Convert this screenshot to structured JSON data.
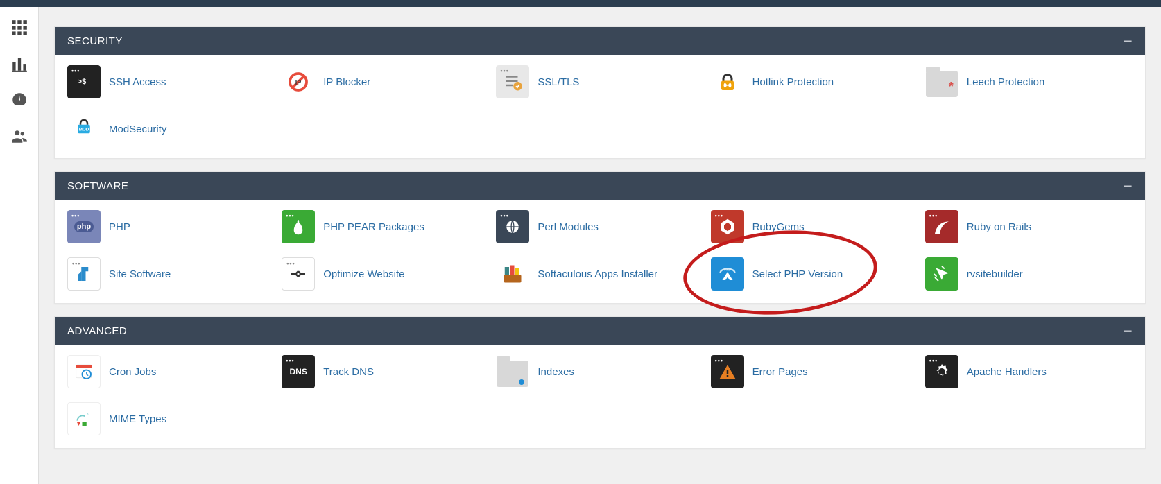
{
  "sidebar": {
    "items": [
      {
        "name": "apps-icon"
      },
      {
        "name": "stats-icon"
      },
      {
        "name": "dashboard-icon"
      },
      {
        "name": "users-icon"
      }
    ]
  },
  "sections": [
    {
      "title": "SECURITY",
      "items": [
        {
          "label": "SSH Access",
          "icon": "ssh"
        },
        {
          "label": "IP Blocker",
          "icon": "ipblocker"
        },
        {
          "label": "SSL/TLS",
          "icon": "ssltls"
        },
        {
          "label": "Hotlink Protection",
          "icon": "hotlink"
        },
        {
          "label": "Leech Protection",
          "icon": "leech"
        },
        {
          "label": "ModSecurity",
          "icon": "modsecurity"
        }
      ]
    },
    {
      "title": "SOFTWARE",
      "items": [
        {
          "label": "PHP",
          "icon": "php"
        },
        {
          "label": "PHP PEAR Packages",
          "icon": "pear"
        },
        {
          "label": "Perl Modules",
          "icon": "perl"
        },
        {
          "label": "RubyGems",
          "icon": "rubygems"
        },
        {
          "label": "Ruby on Rails",
          "icon": "rails"
        },
        {
          "label": "Site Software",
          "icon": "sitesoftware"
        },
        {
          "label": "Optimize Website",
          "icon": "optimize"
        },
        {
          "label": "Softaculous Apps Installer",
          "icon": "softaculous"
        },
        {
          "label": "Select PHP Version",
          "icon": "selectphp",
          "highlight": true
        },
        {
          "label": "rvsitebuilder",
          "icon": "rvsitebuilder"
        }
      ]
    },
    {
      "title": "ADVANCED",
      "items": [
        {
          "label": "Cron Jobs",
          "icon": "cron"
        },
        {
          "label": "Track DNS",
          "icon": "dns"
        },
        {
          "label": "Indexes",
          "icon": "indexes"
        },
        {
          "label": "Error Pages",
          "icon": "errorpages"
        },
        {
          "label": "Apache Handlers",
          "icon": "apache"
        },
        {
          "label": "MIME Types",
          "icon": "mime"
        }
      ]
    }
  ],
  "colors": {
    "header": "#3a4757",
    "link": "#2b6ca3"
  }
}
